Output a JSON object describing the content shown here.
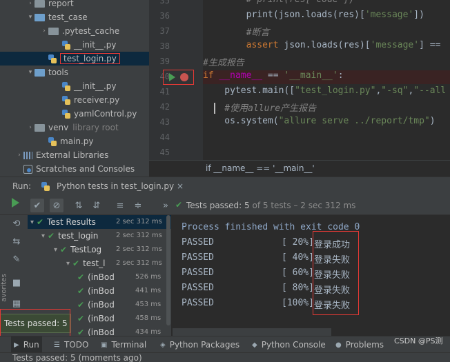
{
  "project_tree": [
    {
      "label": "report",
      "kind": "folder",
      "indent": 1,
      "arrow": "collapsed"
    },
    {
      "label": "test_case",
      "kind": "folder",
      "indent": 1,
      "arrow": "expanded"
    },
    {
      "label": ".pytest_cache",
      "kind": "folder",
      "indent": 2,
      "arrow": "collapsed"
    },
    {
      "label": "__init__.py",
      "kind": "py",
      "indent": 3,
      "arrow": ""
    },
    {
      "label": "test_login.py",
      "kind": "py",
      "indent": 2,
      "arrow": "",
      "selected": true
    },
    {
      "label": "tools",
      "kind": "folder",
      "indent": 1,
      "arrow": "expanded"
    },
    {
      "label": "__init__.py",
      "kind": "py",
      "indent": 3,
      "arrow": ""
    },
    {
      "label": "receiver.py",
      "kind": "py",
      "indent": 3,
      "arrow": ""
    },
    {
      "label": "yamlControl.py",
      "kind": "py",
      "indent": 3,
      "arrow": ""
    },
    {
      "label": "venv",
      "kind": "folder",
      "indent": 1,
      "arrow": "collapsed",
      "hint": "library root"
    },
    {
      "label": "main.py",
      "kind": "py",
      "indent": 2,
      "arrow": ""
    },
    {
      "label": "External Libraries",
      "kind": "lib",
      "indent": 0,
      "arrow": "collapsed"
    },
    {
      "label": "Scratches and Consoles",
      "kind": "scratch",
      "indent": 0,
      "arrow": ""
    }
  ],
  "editor": {
    "line_numbers": [
      "35",
      "36",
      "37",
      "38",
      "39",
      "40",
      "41",
      "42",
      "43",
      "44",
      "45"
    ],
    "lines": [
      {
        "parts": [
          [
            "cmt",
            "        # print(res[\"code\"])"
          ]
        ]
      },
      {
        "parts": [
          [
            "mth",
            "        print(json.loads(res)["
          ],
          [
            "str",
            "'message'"
          ],
          [
            "mth",
            "])"
          ]
        ]
      },
      {
        "parts": [
          [
            "cmt",
            "        #断言"
          ]
        ]
      },
      {
        "parts": [
          [
            "kw",
            "        assert "
          ],
          [
            "mth",
            "json.loads(res)["
          ],
          [
            "str",
            "'message'"
          ],
          [
            "mth",
            "] =="
          ]
        ]
      },
      {
        "parts": [
          [
            "cmt",
            "#生成报告"
          ]
        ]
      },
      {
        "parts": [
          [
            "kw",
            "if "
          ],
          [
            "dunder",
            "__name__"
          ],
          [
            "mth",
            " == "
          ],
          [
            "str",
            "'__main__'"
          ],
          [
            "mth",
            ":"
          ]
        ]
      },
      {
        "parts": [
          [
            "mth",
            "    pytest.main(["
          ],
          [
            "str",
            "\"test_login.py\""
          ],
          [
            "mth",
            ","
          ],
          [
            "str",
            "\"-sq\""
          ],
          [
            "mth",
            ","
          ],
          [
            "str",
            "\"--all"
          ]
        ]
      },
      {
        "parts": [
          [
            "cmt",
            "    #使用allure产生报告"
          ]
        ]
      },
      {
        "parts": [
          [
            "mth",
            "    os.system("
          ],
          [
            "str",
            "\"allure serve ../report/tmp\""
          ],
          [
            "mth",
            ")"
          ]
        ]
      },
      {
        "parts": [
          [
            "mth",
            ""
          ]
        ]
      },
      {
        "parts": [
          [
            "mth",
            ""
          ]
        ]
      }
    ],
    "breadcrumb": "if __name__ == '__main__'"
  },
  "run_panel": {
    "title": "Run:",
    "tab_label": "Python tests in test_login.py",
    "status_text": "Tests passed:",
    "status_count": "5",
    "status_rest": "of 5 tests – 2 sec 312 ms"
  },
  "results_tree": [
    {
      "label": "Test Results",
      "time": "2 sec 312 ms",
      "indent": 0,
      "arrow": true
    },
    {
      "label": "test_login",
      "time": "2 sec 312 ms",
      "indent": 1,
      "arrow": true
    },
    {
      "label": "TestLog",
      "time": "2 sec 312 ms",
      "indent": 2,
      "arrow": true
    },
    {
      "label": "test_l",
      "time": "2 sec 312 ms",
      "indent": 3,
      "arrow": true
    },
    {
      "label": "(inBod",
      "time": "526 ms",
      "indent": 4,
      "arrow": false
    },
    {
      "label": "(inBod",
      "time": "441 ms",
      "indent": 4,
      "arrow": false
    },
    {
      "label": "(inBod",
      "time": "453 ms",
      "indent": 4,
      "arrow": false
    },
    {
      "label": "(inBod",
      "time": "458 ms",
      "indent": 4,
      "arrow": false
    },
    {
      "label": "(inBod",
      "time": "434 ms",
      "indent": 4,
      "arrow": false
    }
  ],
  "console": {
    "header": "Process finished with exit code 0",
    "rows": [
      {
        "status": "PASSED",
        "percent": "[ 20%]",
        "message": "登录成功"
      },
      {
        "status": "PASSED",
        "percent": "[ 40%]",
        "message": "登录失败"
      },
      {
        "status": "PASSED",
        "percent": "[ 60%]",
        "message": "登录失败"
      },
      {
        "status": "PASSED",
        "percent": "[ 80%]",
        "message": "登录失败"
      },
      {
        "status": "PASSED",
        "percent": "[100%]",
        "message": "登录失败"
      }
    ]
  },
  "popup": "Tests passed: 5",
  "bottom_tabs": [
    {
      "label": "Run",
      "icon": "run-icon"
    },
    {
      "label": "TODO",
      "icon": "todo-icon"
    },
    {
      "label": "Terminal",
      "icon": "terminal-icon"
    },
    {
      "label": "Python Packages",
      "icon": "packages-icon"
    },
    {
      "label": "Python Console",
      "icon": "python-console-icon"
    },
    {
      "label": "Problems",
      "icon": "problems-icon"
    }
  ],
  "status_bar": "Tests passed: 5 (moments ago)",
  "watermark": "CSDN @PS测",
  "side_label": "avorites",
  "colors": {
    "pass": "#499c54",
    "highlight": "#e53935",
    "selection": "#0d293e"
  }
}
